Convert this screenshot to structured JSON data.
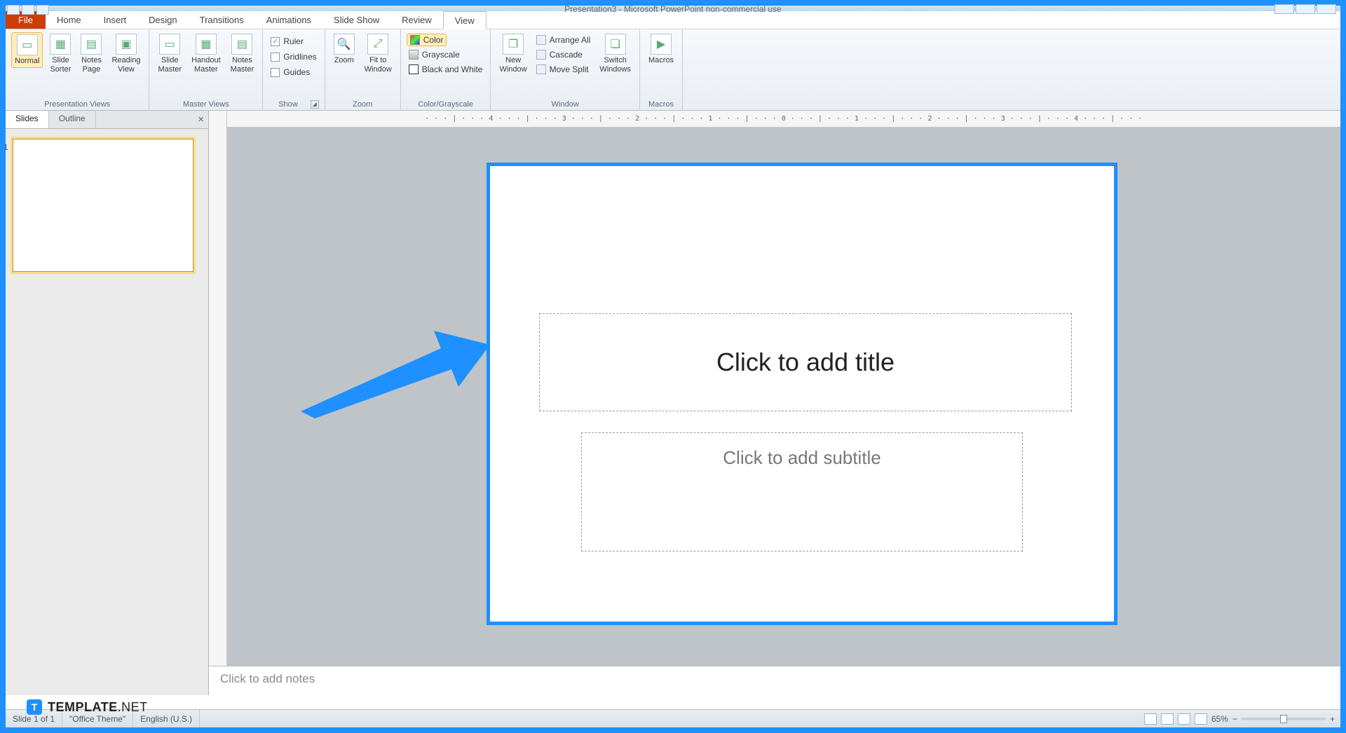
{
  "app_title": "Presentation3 - Microsoft PowerPoint non-commercial use",
  "tabs": {
    "file": "File",
    "items": [
      "Home",
      "Insert",
      "Design",
      "Transitions",
      "Animations",
      "Slide Show",
      "Review",
      "View"
    ],
    "active": "View"
  },
  "ribbon": {
    "presentation_views": {
      "label": "Presentation Views",
      "normal": "Normal",
      "sorter": "Slide\nSorter",
      "notes_page": "Notes\nPage",
      "reading": "Reading\nView"
    },
    "master_views": {
      "label": "Master Views",
      "slide_master": "Slide\nMaster",
      "handout_master": "Handout\nMaster",
      "notes_master": "Notes\nMaster"
    },
    "show": {
      "label": "Show",
      "ruler": "Ruler",
      "gridlines": "Gridlines",
      "guides": "Guides"
    },
    "zoom": {
      "label": "Zoom",
      "zoom": "Zoom",
      "fit": "Fit to\nWindow"
    },
    "color": {
      "label": "Color/Grayscale",
      "color": "Color",
      "grayscale": "Grayscale",
      "bw": "Black and White"
    },
    "window": {
      "label": "Window",
      "new_window": "New\nWindow",
      "arrange_all": "Arrange All",
      "cascade": "Cascade",
      "move_split": "Move Split",
      "switch": "Switch\nWindows"
    },
    "macros": {
      "label": "Macros",
      "macros": "Macros"
    }
  },
  "side_tabs": {
    "slides": "Slides",
    "outline": "Outline"
  },
  "slide": {
    "title_placeholder": "Click to add title",
    "subtitle_placeholder": "Click to add subtitle"
  },
  "notes_placeholder": "Click to add notes",
  "status": {
    "slide": "Slide 1 of 1",
    "theme": "\"Office Theme\"",
    "lang": "English (U.S.)",
    "zoom": "65%"
  },
  "ruler_h_text": "· · · | · · · 4 · · · | · · · 3 · · · | · · · 2 · · · | · · · 1 · · · | · · · 0 · · · | · · · 1 · · · | · · · 2 · · · | · · · 3 · · · | · · · 4 · · · | · · ·",
  "watermark": {
    "badge": "T",
    "brand_bold": "TEMPLATE",
    "brand_light": ".NET"
  }
}
